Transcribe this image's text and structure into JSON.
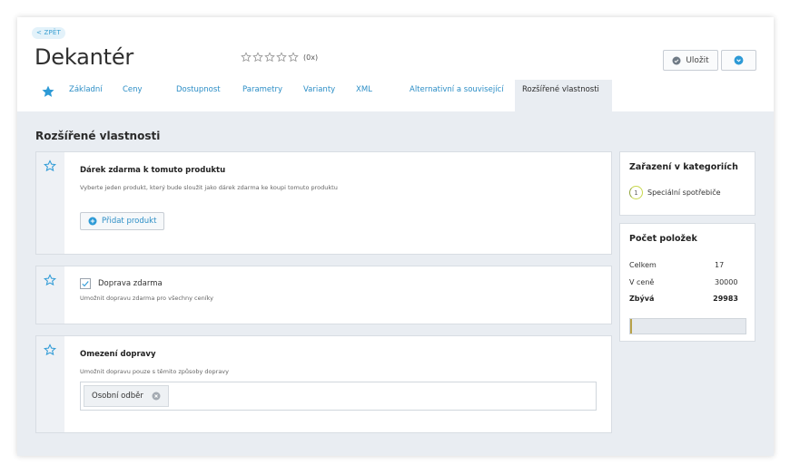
{
  "header": {
    "back_label": "< ZPĚT",
    "title": "Dekantér",
    "rating": {
      "stars_max": 5,
      "stars_filled": 0,
      "count_label": "(0x)"
    },
    "save_label": "Uložit"
  },
  "tabs": [
    {
      "label": "Základní"
    },
    {
      "label": "Ceny"
    },
    {
      "label": "Dostupnost"
    },
    {
      "label": "Parametry"
    },
    {
      "label": "Varianty"
    },
    {
      "label": "XML"
    },
    {
      "label": "Alternativní a související"
    },
    {
      "label": "Rozšířené vlastnosti",
      "active": true
    }
  ],
  "main": {
    "section_title": "Rozšířené vlastnosti",
    "gift": {
      "title": "Dárek zdarma k tomuto produktu",
      "description": "Vyberte jeden produkt, který bude sloužit jako dárek zdarma ke koupi tomuto produktu",
      "add_button_label": "Přidat produkt"
    },
    "free_shipping": {
      "label": "Doprava zdarma",
      "checked": true,
      "description": "Umožnit dopravu zdarma pro všechny ceníky"
    },
    "shipping_limit": {
      "title": "Omezení dopravy",
      "description": "Umožnit dopravu pouze s těmito způsoby dopravy",
      "chips": [
        "Osobní odběr"
      ]
    }
  },
  "sidebar": {
    "categories": {
      "title": "Zařazení v kategoriích",
      "items": [
        {
          "number": "1",
          "label": "Speciální spotřebiče"
        }
      ]
    },
    "count": {
      "title": "Počet položek",
      "rows": [
        {
          "label": "Celkem",
          "value": "17",
          "bold": false
        },
        {
          "label": "V ceně",
          "value": "30000",
          "bold": false
        },
        {
          "label": "Zbývá",
          "value": "29983",
          "bold": true
        }
      ],
      "progress_fraction": 0.0006
    }
  },
  "colors": {
    "accent": "#2c8ec6",
    "star_blue": "#2d9ad6",
    "content_bg": "#e9edf2",
    "progress_fill": "#b8a24a"
  }
}
